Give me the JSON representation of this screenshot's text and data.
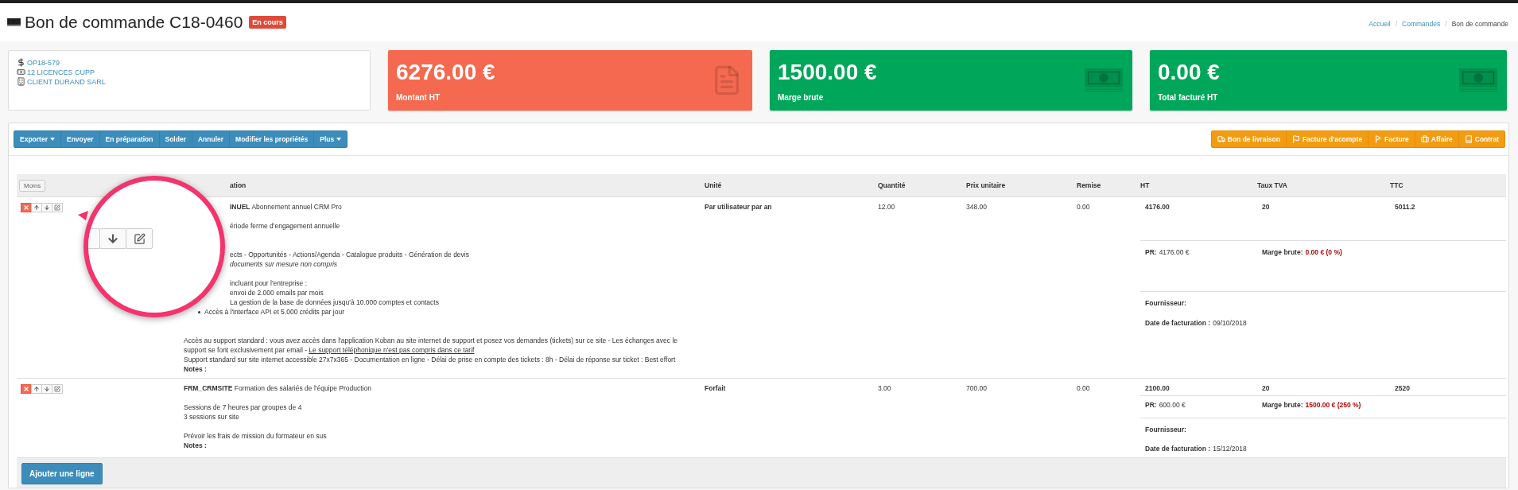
{
  "page_title": {
    "text": "Bon de commande C18-0460",
    "status": "En cours"
  },
  "breadcrumb": [
    {
      "kind": "link",
      "label": "Accueil"
    },
    {
      "kind": "separator",
      "label": "/"
    },
    {
      "kind": "link",
      "label": "Commandes"
    },
    {
      "kind": "separator",
      "label": "/"
    },
    {
      "kind": "current",
      "label": "Bon de commande"
    }
  ],
  "info_links": [
    {
      "kind": "dollar",
      "text": "OP18-579"
    },
    {
      "kind": "money",
      "text": "12 LICENCES CUPP"
    },
    {
      "kind": "building",
      "text": "CLIENT DURAND SARL"
    }
  ],
  "stat_cards": [
    {
      "value": "6276.00 €",
      "label": "Montant HT",
      "color": "#f4694f",
      "kind": "file"
    },
    {
      "value": "1500.00 €",
      "label": "Marge brute",
      "color": "#00a65a",
      "kind": "money"
    },
    {
      "value": "0.00 €",
      "label": "Total facturé HT",
      "color": "#00a65a",
      "kind": "money"
    }
  ],
  "toolbar_left": [
    {
      "label": "Exporter",
      "dropdown": true
    },
    {
      "label": "Envoyer",
      "dropdown": false
    },
    {
      "label": "En préparation",
      "dropdown": false
    },
    {
      "label": "Solder",
      "dropdown": false
    },
    {
      "label": "Annuler",
      "dropdown": false
    },
    {
      "label": "Modifier les propriétés",
      "dropdown": false
    },
    {
      "label": "Plus",
      "dropdown": true
    }
  ],
  "toolbar_right": [
    {
      "label": "Bon de livraison",
      "kind": "truck"
    },
    {
      "label": "Facture d'acompte",
      "kind": "flag"
    },
    {
      "label": "Facture",
      "kind": "checkered"
    },
    {
      "label": "Affaire",
      "kind": "briefcase"
    },
    {
      "label": "Contrat",
      "kind": "book"
    }
  ],
  "table": {
    "less_button": "Moins",
    "columns": [
      "ation",
      "Unité",
      "Quantité",
      "Prix unitaire",
      "Remise",
      "HT",
      "Taux TVA",
      "TTC"
    ],
    "rows": [
      {
        "lines": [
          {
            "kind": "heading",
            "text": "**INUEL** Abonnement annuel CRM Pro",
            "clipped": true
          },
          {
            "kind": "blank"
          },
          {
            "kind": "text",
            "text": "ériode ferme d'engagement annuelle",
            "clipped": true
          },
          {
            "kind": "blank"
          },
          {
            "kind": "blank"
          },
          {
            "kind": "text",
            "text": "ects - Opportunités - Actions/Agenda - Catalogue produits - Génération de devis",
            "clipped": true
          },
          {
            "kind": "italic",
            "text": "documents sur mesure non compris",
            "clipped": true
          },
          {
            "kind": "blank"
          },
          {
            "kind": "text",
            "text": "incluant pour l'entreprise :",
            "clipped": true
          },
          {
            "kind": "text",
            "text": "envoi de 2.000 emails par mois",
            "clipped": true
          },
          {
            "kind": "text",
            "text": "La gestion de la base de données jusqu'à 10.000 comptes et contacts",
            "clipped": true
          },
          {
            "kind": "bullet",
            "text": "Accès à l'interface API et 5.000 crédits par jour",
            "clipped": false
          },
          {
            "kind": "blank"
          },
          {
            "kind": "blank"
          },
          {
            "kind": "paragraph",
            "text": "Accès au support standard : vous avez accès dans l'application Koban au site internet de support et posez vos demandes (tickets) sur ce site - Les échanges avec le support se font exclusivement par email - ",
            "link": "Le support téléphonique n'est pas compris dans ce tarif",
            "clipped": false
          },
          {
            "kind": "text",
            "text": "Support standard sur site internet accessible  27x7x365 - Documentation en ligne - Délai de prise en compte des tickets : 8h - Délai de réponse sur ticket : Best effort",
            "clipped": false
          },
          {
            "kind": "notes",
            "text": "Notes :",
            "clipped": false
          }
        ],
        "unit": "Par utilisateur par an",
        "quantity": "12.00",
        "unit_price": "348.00",
        "discount": "0.00",
        "ht": "4176.00",
        "vat": "20",
        "ttc": "5011.2",
        "pr_label": "PR:",
        "pr": "4176.00 €",
        "margin_label": "Marge brute:",
        "margin": "0.00 € (0 %)",
        "supplier_label": "Fournisseur:",
        "date_label": "Date de facturation :",
        "date": "09/10/2018"
      },
      {
        "lines": [
          {
            "kind": "heading",
            "text": "**FRM_CRMSITE** Formation des salariés de l'équipe Production",
            "clipped": false
          },
          {
            "kind": "blank"
          },
          {
            "kind": "text",
            "text": "Sessions de 7 heures par groupes de 4",
            "clipped": false
          },
          {
            "kind": "text",
            "text": "3 sessions sur site",
            "clipped": false
          },
          {
            "kind": "blank"
          },
          {
            "kind": "text",
            "text": "Prévoir les frais de mission du formateur en sus",
            "clipped": false
          },
          {
            "kind": "notes",
            "text": "Notes :",
            "clipped": false
          }
        ],
        "unit": "Forfait",
        "quantity": "3.00",
        "unit_price": "700.00",
        "discount": "0.00",
        "ht": "2100.00",
        "vat": "20",
        "ttc": "2520",
        "pr_label": "PR:",
        "pr": "600.00 €",
        "margin_label": "Marge brute:",
        "margin": "1500.00 € (250 %)",
        "supplier_label": "Fournisseur:",
        "date_label": "Date de facturation :",
        "date": "15/12/2018"
      }
    ]
  },
  "add_button": "Ajouter une ligne"
}
